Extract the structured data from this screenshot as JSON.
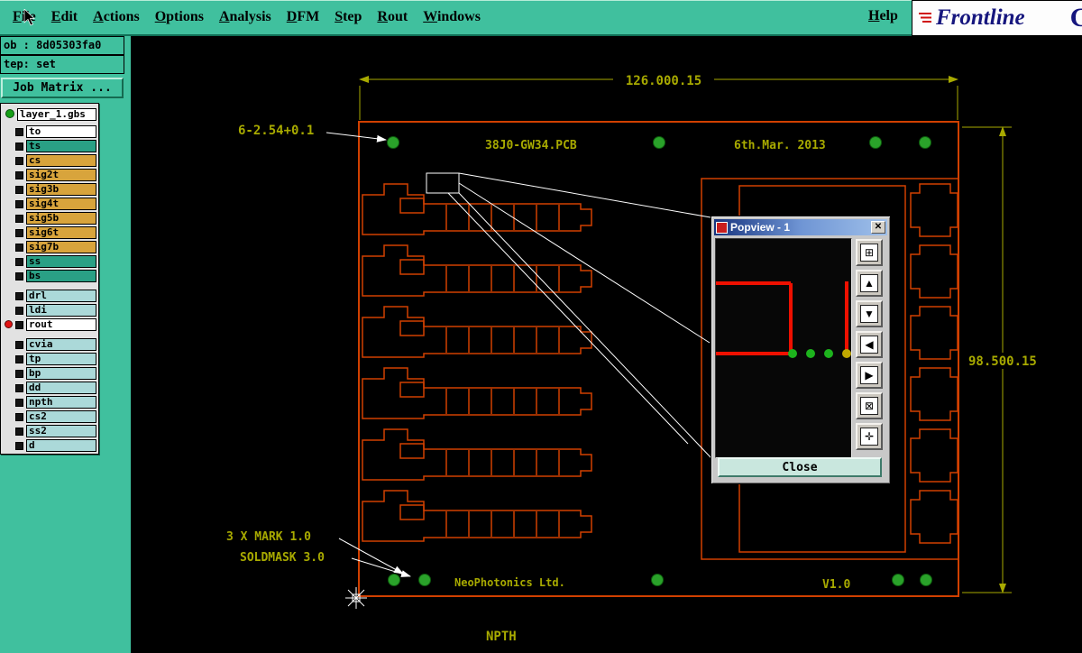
{
  "app": {
    "accent_teal": "#40c09e",
    "pcb_orange": "#d14000",
    "dimension_olive": "#a8aa00",
    "trace_red": "#ee1000",
    "fiducial_green": "#2aa22a"
  },
  "menu": {
    "items": [
      {
        "label": "File"
      },
      {
        "label": "Edit"
      },
      {
        "label": "Actions"
      },
      {
        "label": "Options"
      },
      {
        "label": "Analysis"
      },
      {
        "label": "DFM"
      },
      {
        "label": "Step"
      },
      {
        "label": "Rout"
      },
      {
        "label": "Windows"
      }
    ],
    "help_label": "Help",
    "logo_text": "Frontline",
    "logo_suffix": "G"
  },
  "job_panel": {
    "job_label": "ob : 8d05303fa0",
    "step_label": "tep: set",
    "job_matrix_button": "Job Matrix ..."
  },
  "layers": {
    "active": {
      "name": "layer_1.gbs"
    },
    "groups": [
      {
        "rows": [
          {
            "name": "to",
            "color": "white"
          },
          {
            "name": "ts",
            "color": "teal"
          },
          {
            "name": "cs",
            "color": "gold"
          },
          {
            "name": "sig2t",
            "color": "gold"
          },
          {
            "name": "sig3b",
            "color": "gold"
          },
          {
            "name": "sig4t",
            "color": "gold"
          },
          {
            "name": "sig5b",
            "color": "gold"
          },
          {
            "name": "sig6t",
            "color": "gold"
          },
          {
            "name": "sig7b",
            "color": "gold"
          },
          {
            "name": "ss",
            "color": "teal"
          },
          {
            "name": "bs",
            "color": "teal"
          }
        ]
      },
      {
        "rows": [
          {
            "name": "drl",
            "color": "blue"
          },
          {
            "name": "ldi",
            "color": "blue"
          },
          {
            "name": "rout",
            "color": "white",
            "indicator": "red"
          }
        ]
      },
      {
        "rows": [
          {
            "name": "cvia",
            "color": "blue"
          },
          {
            "name": "tp",
            "color": "blue"
          },
          {
            "name": "bp",
            "color": "blue"
          },
          {
            "name": "dd",
            "color": "blue"
          },
          {
            "name": "npth",
            "color": "blue"
          },
          {
            "name": "cs2",
            "color": "blue"
          },
          {
            "name": "ss2",
            "color": "blue"
          },
          {
            "name": "d",
            "color": "blue"
          }
        ]
      }
    ]
  },
  "drawing": {
    "dim_width": "126.000.15",
    "dim_height": "98.500.15",
    "hole_note": "6-2.54+0.1",
    "board_title": "38J0-GW34.PCB",
    "board_date": "6th.Mar. 2013",
    "mark_note": "3 X MARK  1.0",
    "soldmask_note": "SOLDMASK  3.0",
    "company": "NeoPhotonics Ltd.",
    "version": "V1.0",
    "bottom_label": "NPTH"
  },
  "popview": {
    "title": "Popview - 1",
    "close_label": "Close",
    "close_x": "✕",
    "tools": [
      {
        "name": "zoom-window",
        "glyph": "⊞"
      },
      {
        "name": "zoom-in",
        "glyph": "▲"
      },
      {
        "name": "zoom-out",
        "glyph": "▼"
      },
      {
        "name": "pan-left",
        "glyph": "◀"
      },
      {
        "name": "pan-right",
        "glyph": "▶"
      },
      {
        "name": "zoom-fit",
        "glyph": "⊠"
      },
      {
        "name": "pan-move",
        "glyph": "✛"
      }
    ]
  }
}
